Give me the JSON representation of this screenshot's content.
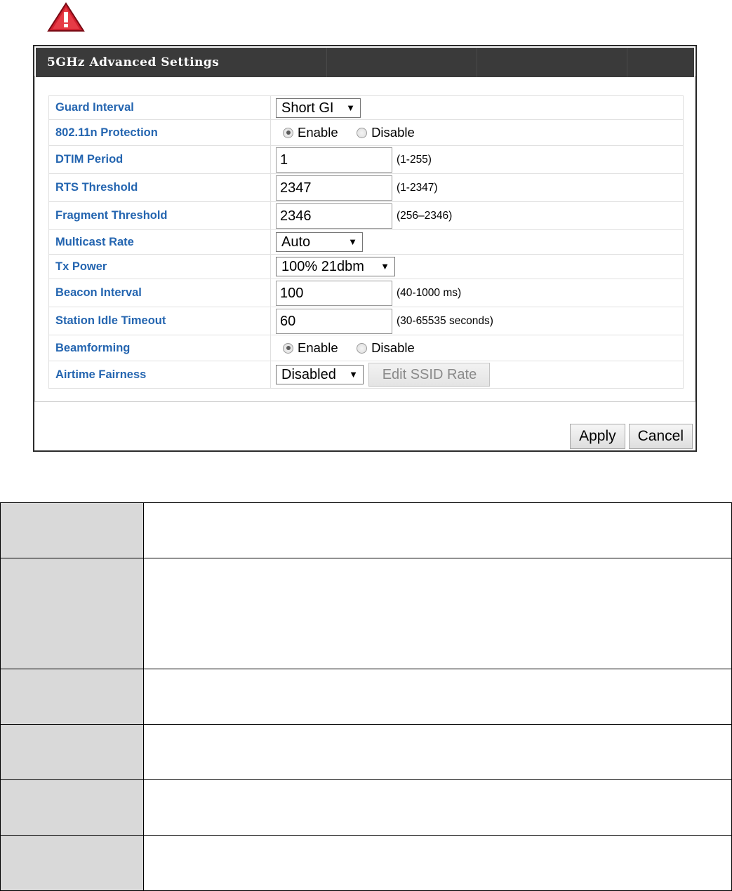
{
  "panel": {
    "title": "5GHz Advanced Settings"
  },
  "settings": {
    "guard_interval": {
      "label": "Guard Interval",
      "value": "Short GI",
      "arrow": "▼"
    },
    "protection": {
      "label": "802.11n Protection",
      "enable": "Enable",
      "disable": "Disable",
      "selected": "Enable"
    },
    "dtim": {
      "label": "DTIM Period",
      "value": "1",
      "hint": "(1-255)"
    },
    "rts": {
      "label": "RTS Threshold",
      "value": "2347",
      "hint": "(1-2347)"
    },
    "fragment": {
      "label": "Fragment Threshold",
      "value": "2346",
      "hint": "(256–2346)"
    },
    "multicast": {
      "label": "Multicast Rate",
      "value": "Auto",
      "arrow": "▼"
    },
    "tx_power": {
      "label": "Tx Power",
      "value": "100% 21dbm",
      "arrow": "▼"
    },
    "beacon": {
      "label": "Beacon Interval",
      "value": "100",
      "hint": "(40-1000 ms)"
    },
    "idle_timeout": {
      "label": "Station Idle Timeout",
      "value": "60",
      "hint": "(30-65535 seconds)"
    },
    "beamforming": {
      "label": "Beamforming",
      "enable": "Enable",
      "disable": "Disable",
      "selected": "Enable"
    },
    "airtime": {
      "label": "Airtime Fairness",
      "value": "Disabled",
      "arrow": "▼",
      "edit_button": "Edit SSID Rate"
    }
  },
  "buttons": {
    "apply": "Apply",
    "cancel": "Cancel"
  },
  "colors": {
    "label_blue": "#2465b0",
    "header_bg": "#3a3a3a",
    "warning_red": "#c8102e"
  },
  "icons": {
    "warning": "warning-triangle-icon"
  }
}
